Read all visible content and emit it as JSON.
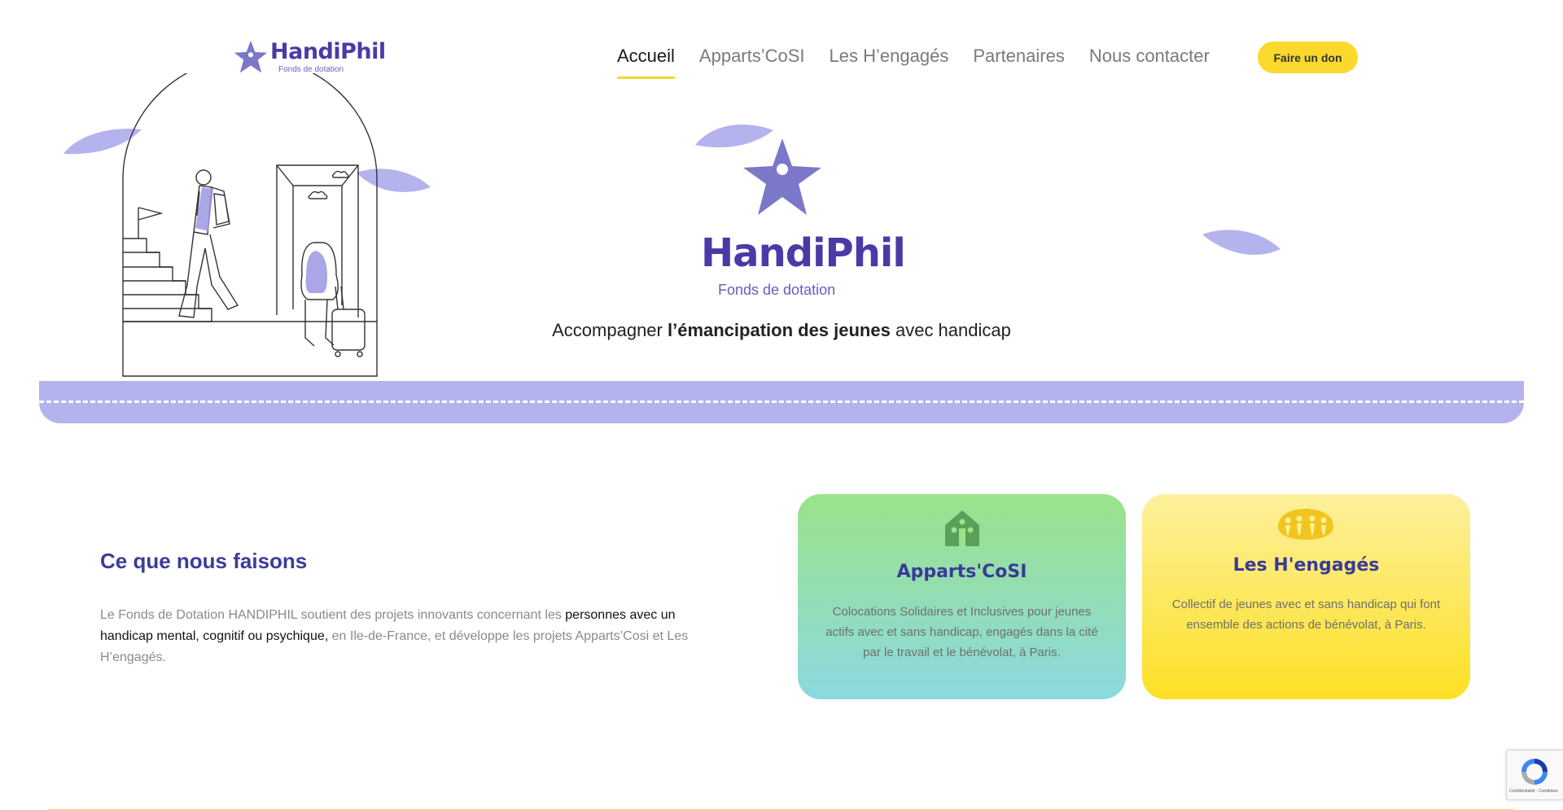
{
  "header": {
    "logo": {
      "name": "HandiPhil",
      "subtitle": "Fonds de dotation"
    },
    "nav": [
      {
        "label": "Accueil",
        "active": true
      },
      {
        "label": "Apparts’CoSI",
        "active": false
      },
      {
        "label": "Les H’engagés",
        "active": false
      },
      {
        "label": "Partenaires",
        "active": false
      },
      {
        "label": "Nous contacter",
        "active": false
      }
    ],
    "donate_label": "Faire un don"
  },
  "hero": {
    "logo_name": "HandiPhil",
    "logo_subtitle": "Fonds de dotation",
    "tagline_pre": "Accompagner ",
    "tagline_bold": "l’émancipation des jeunes",
    "tagline_post": " avec handicap"
  },
  "what": {
    "title": "Ce que nous faisons",
    "text_1": "Le Fonds de Dotation HANDIPHIL soutient des projets innovants concernant les ",
    "text_highlight": "personnes avec un handicap mental, cognitif ou psychique,",
    "text_2": " en Ile-de-France, et développe les projets Apparts’Cosi et Les H’engagés."
  },
  "cards": [
    {
      "title": "Apparts'CoSI",
      "description": "Colocations Solidaires et Inclusives pour jeunes actifs avec et sans handicap, engagés dans la cité par le travail et le bénévolat, à Paris."
    },
    {
      "title": "Les H'engagés",
      "description": "Collectif de jeunes avec et sans handicap qui font ensemble des actions de bénévolat, à Paris."
    }
  ],
  "recaptcha": {
    "text": "Confidentialité - Conditions"
  },
  "colors": {
    "brand_purple": "#4a3aa8",
    "leaf_lavender": "#b4b3ee",
    "accent_yellow": "#fbd92c",
    "card_green_top": "#9be289",
    "card_teal_bottom": "#8bd9df",
    "card_yellow_top": "#fdf09c",
    "card_yellow_bottom": "#fde024"
  },
  "icons": [
    "handiphil-star-logo",
    "leaf-decoration",
    "house-people-icon",
    "group-people-icon",
    "recaptcha-icon"
  ]
}
